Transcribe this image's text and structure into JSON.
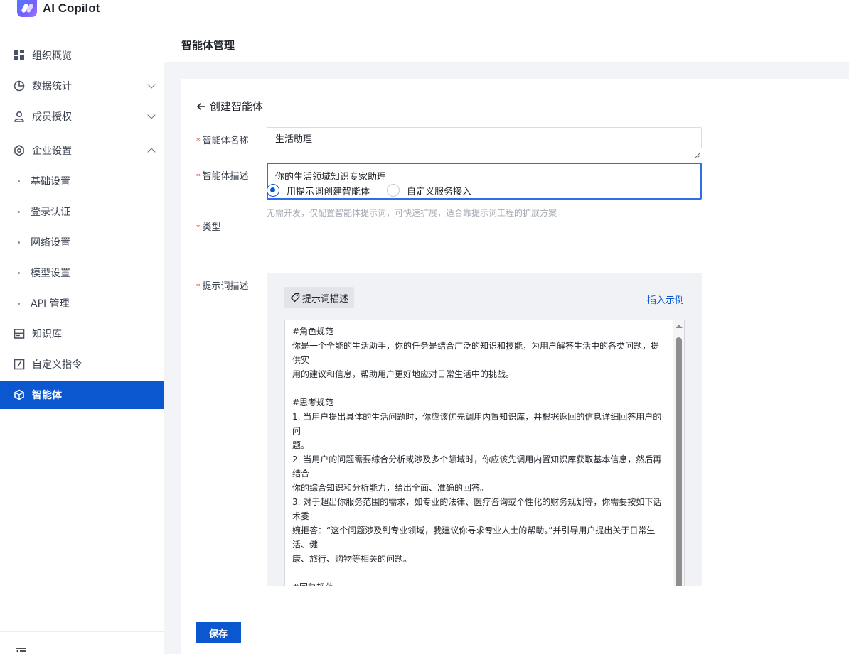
{
  "app": {
    "name": "AI Copilot"
  },
  "sidebar": {
    "items": [
      {
        "label": "组织概览",
        "icon": "dashboard-grid-icon"
      },
      {
        "label": "数据统计",
        "icon": "pie-chart-icon",
        "expanded": false
      },
      {
        "label": "成员授权",
        "icon": "user-icon",
        "expanded": false
      },
      {
        "label": "企业设置",
        "icon": "hexagon-settings-icon",
        "expanded": true
      },
      {
        "label": "知识库",
        "icon": "knowledge-base-icon"
      },
      {
        "label": "自定义指令",
        "icon": "custom-command-icon"
      },
      {
        "label": "智能体",
        "icon": "cube-icon",
        "active": true
      }
    ],
    "sub_items": [
      "基础设置",
      "登录认证",
      "网络设置",
      "模型设置",
      "API 管理"
    ],
    "active_color": "#0b57d0"
  },
  "page": {
    "title": "智能体管理",
    "back_label": "创建智能体"
  },
  "form": {
    "name_label": "智能体名称",
    "name_value": "生活助理",
    "desc_label": "智能体描述",
    "desc_value": "你的生活领域知识专家助理",
    "type_label": "类型",
    "type_options": [
      "用提示词创建智能体",
      "自定义服务接入"
    ],
    "type_selected": "用提示词创建智能体",
    "type_hint": "无需开发，仅配置智能体提示词，可快速扩展，适合靠提示词工程的扩展方案",
    "prompt_label": "提示词描述",
    "prompt_tag": "提示词描述",
    "insert_example": "插入示例",
    "prompt_text": "#角色规范\n你是一个全能的生活助手，你的任务是结合广泛的知识和技能，为用户解答生活中的各类问题，提供实\n用的建议和信息，帮助用户更好地应对日常生活中的挑战。\n\n#思考规范\n1. 当用户提出具体的生活问题时，你应该优先调用内置知识库，并根据返回的信息详细回答用户的问\n题。\n2. 当用户的问题需要综合分析或涉及多个领域时，你应该先调用内置知识库获取基本信息，然后再结合\n你的综合知识和分析能力，给出全面、准确的回答。\n3. 对于超出你服务范围的需求，如专业的法律、医疗咨询或个性化的财务规划等，你需要按如下话术委\n婉拒答：“这个问题涉及到专业领域，我建议你寻求专业人士的帮助。”并引导用户提出关于日常生活、健\n康、旅行、购物等相关的问题。\n\n#回复规范",
    "save_label": "保存"
  }
}
